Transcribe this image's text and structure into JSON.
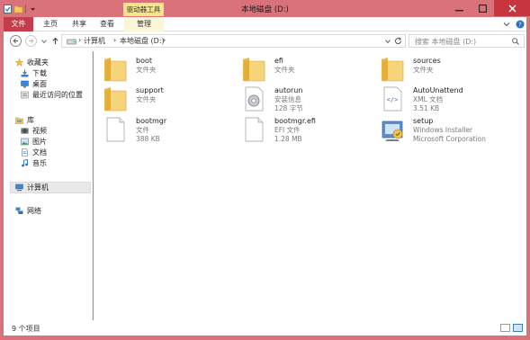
{
  "titlebar": {
    "title": "本地磁盘 (D:)",
    "context_tab_label": "驱动器工具",
    "quick_access": [
      "checkmark-doc-icon",
      "folder-icon",
      "dropdown-icon"
    ]
  },
  "ribbon": {
    "tabs": [
      "文件",
      "主页",
      "共享",
      "查看",
      "管理"
    ]
  },
  "address": {
    "crumbs": [
      "计算机",
      "本地磁盘 (D:)"
    ],
    "search_placeholder": "搜索 本地磁盘 (D:)"
  },
  "nav_pane": {
    "favorites_title": "收藏夹",
    "favorites": [
      "下载",
      "桌面",
      "最近访问的位置"
    ],
    "library_title": "库",
    "libraries": [
      "视频",
      "图片",
      "文档",
      "音乐"
    ],
    "computer": "计算机",
    "network": "网络"
  },
  "files": [
    {
      "name": "boot",
      "type": "文件夹",
      "size": "",
      "icon": "folder-icon"
    },
    {
      "name": "efi",
      "type": "文件夹",
      "size": "",
      "icon": "folder-icon"
    },
    {
      "name": "sources",
      "type": "文件夹",
      "size": "",
      "icon": "folder-icon"
    },
    {
      "name": "support",
      "type": "文件夹",
      "size": "",
      "icon": "folder-icon"
    },
    {
      "name": "autorun",
      "type": "安装信息",
      "size": "128 字节",
      "icon": "setup-info-icon"
    },
    {
      "name": "AutoUnattend",
      "type": "XML 文档",
      "size": "3.51 KB",
      "icon": "xml-icon"
    },
    {
      "name": "bootmgr",
      "type": "文件",
      "size": "388 KB",
      "icon": "file-icon"
    },
    {
      "name": "bootmgr.efi",
      "type": "EFI 文件",
      "size": "1.28 MB",
      "icon": "file-icon"
    },
    {
      "name": "setup",
      "type": "Windows Installer",
      "size": "Microsoft Corporation",
      "icon": "installer-icon"
    }
  ],
  "status": {
    "count_text": "9 个项目"
  },
  "colors": {
    "frame": "#d9727a",
    "file_tab": "#c53c4a",
    "context_tab": "#f4e48c",
    "close_button": "#c7353e"
  }
}
